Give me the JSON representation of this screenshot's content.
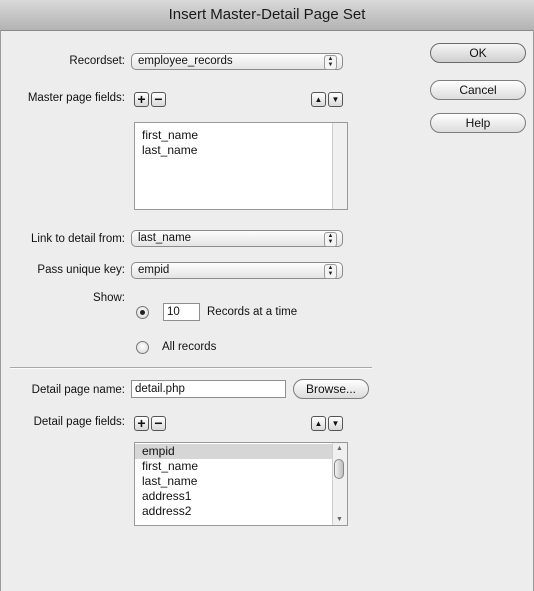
{
  "dialog": {
    "title": "Insert Master-Detail Page Set"
  },
  "buttons": {
    "ok": "OK",
    "cancel": "Cancel",
    "help": "Help",
    "browse": "Browse..."
  },
  "recordset": {
    "label": "Recordset:",
    "value": "employee_records"
  },
  "master_fields": {
    "label": "Master page fields:",
    "add": "+",
    "remove": "−",
    "items": [
      "first_name",
      "last_name"
    ]
  },
  "link_detail": {
    "label": "Link to detail from:",
    "value": "last_name"
  },
  "unique_key": {
    "label": "Pass unique key:",
    "value": "empid"
  },
  "show": {
    "label": "Show:",
    "count": "10",
    "records_at_time": "Records at a time",
    "all_records": "All records",
    "selected": "records_at_time"
  },
  "detail_page": {
    "label": "Detail page name:",
    "value": "detail.php"
  },
  "detail_fields": {
    "label": "Detail page fields:",
    "add": "+",
    "remove": "−",
    "items": [
      "empid",
      "first_name",
      "last_name",
      "address1",
      "address2"
    ],
    "selected_index": 0
  },
  "icons": {
    "popup_arrows": "popup-arrows-icon",
    "move_up": "move-up-icon",
    "move_down": "move-down-icon",
    "scroll_up": "scroll-up-icon",
    "scroll_down": "scroll-down-icon"
  }
}
